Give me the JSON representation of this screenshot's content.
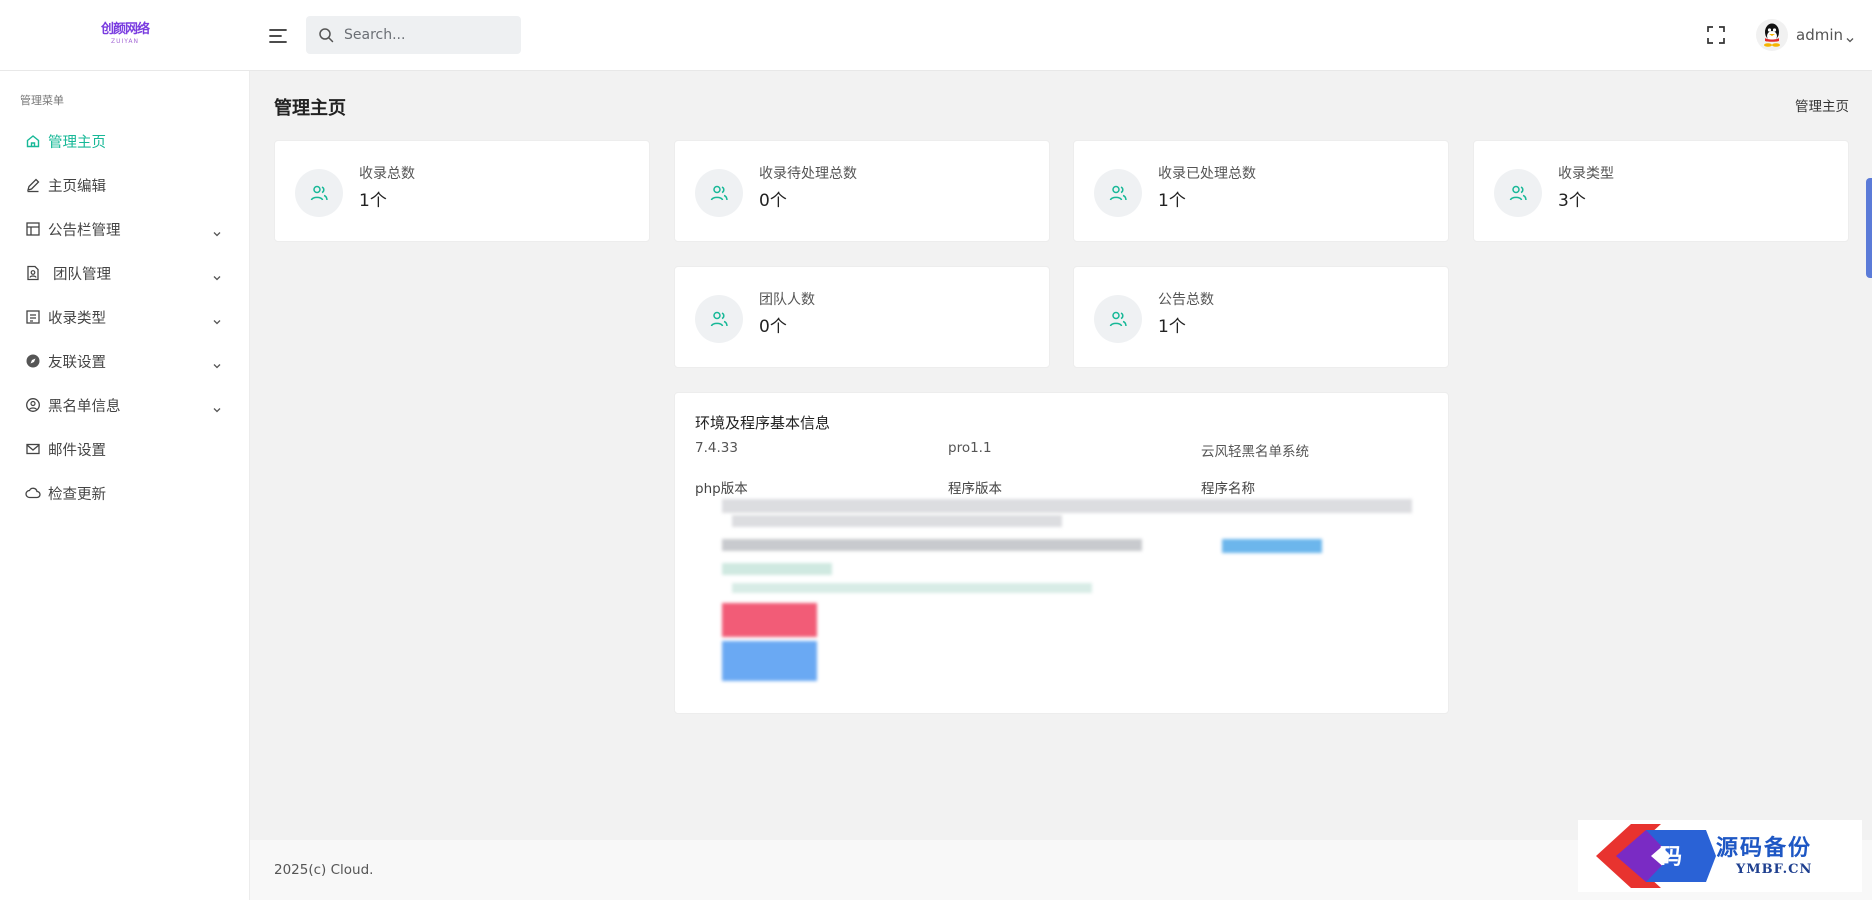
{
  "header": {
    "logo_text": "创颜网络",
    "logo_sub": "ZUIYAN",
    "search_placeholder": "Search...",
    "user_name": "admin"
  },
  "sidebar": {
    "title": "管理菜单",
    "items": [
      {
        "label": "管理主页",
        "icon": "home-icon",
        "active": true
      },
      {
        "label": "主页编辑",
        "icon": "edit-icon"
      },
      {
        "label": "公告栏管理",
        "icon": "layout-icon",
        "has_children": true
      },
      {
        "label": "团队管理",
        "icon": "team-icon",
        "has_children": true
      },
      {
        "label": "收录类型",
        "icon": "list-icon",
        "has_children": true
      },
      {
        "label": "友联设置",
        "icon": "compass-icon",
        "has_children": true
      },
      {
        "label": "黑名单信息",
        "icon": "user-circle-icon",
        "has_children": true
      },
      {
        "label": "邮件设置",
        "icon": "mail-icon"
      },
      {
        "label": "检查更新",
        "icon": "cloud-icon"
      }
    ]
  },
  "main": {
    "page_title": "管理主页",
    "breadcrumb": "管理主页",
    "stats": [
      {
        "label": "收录总数",
        "value": "1个"
      },
      {
        "label": "收录待处理总数",
        "value": "0个"
      },
      {
        "label": "收录已处理总数",
        "value": "1个"
      },
      {
        "label": "收录类型",
        "value": "3个"
      },
      {
        "label": "团队人数",
        "value": "0个"
      },
      {
        "label": "公告总数",
        "value": "1个"
      }
    ],
    "info": {
      "title": "环境及程序基本信息",
      "values": [
        "7.4.33",
        "pro1.1",
        "云风轻黑名单系统"
      ],
      "keys": [
        "php版本",
        "程序版本",
        "程序名称"
      ]
    }
  },
  "footer": {
    "text": "2025(c) Cloud."
  },
  "watermark": {
    "text": "源码备份",
    "sub": "YMBF.CN",
    "glyph": "码"
  },
  "colors": {
    "accent": "#17b897",
    "stat_icon": "#17b897"
  }
}
